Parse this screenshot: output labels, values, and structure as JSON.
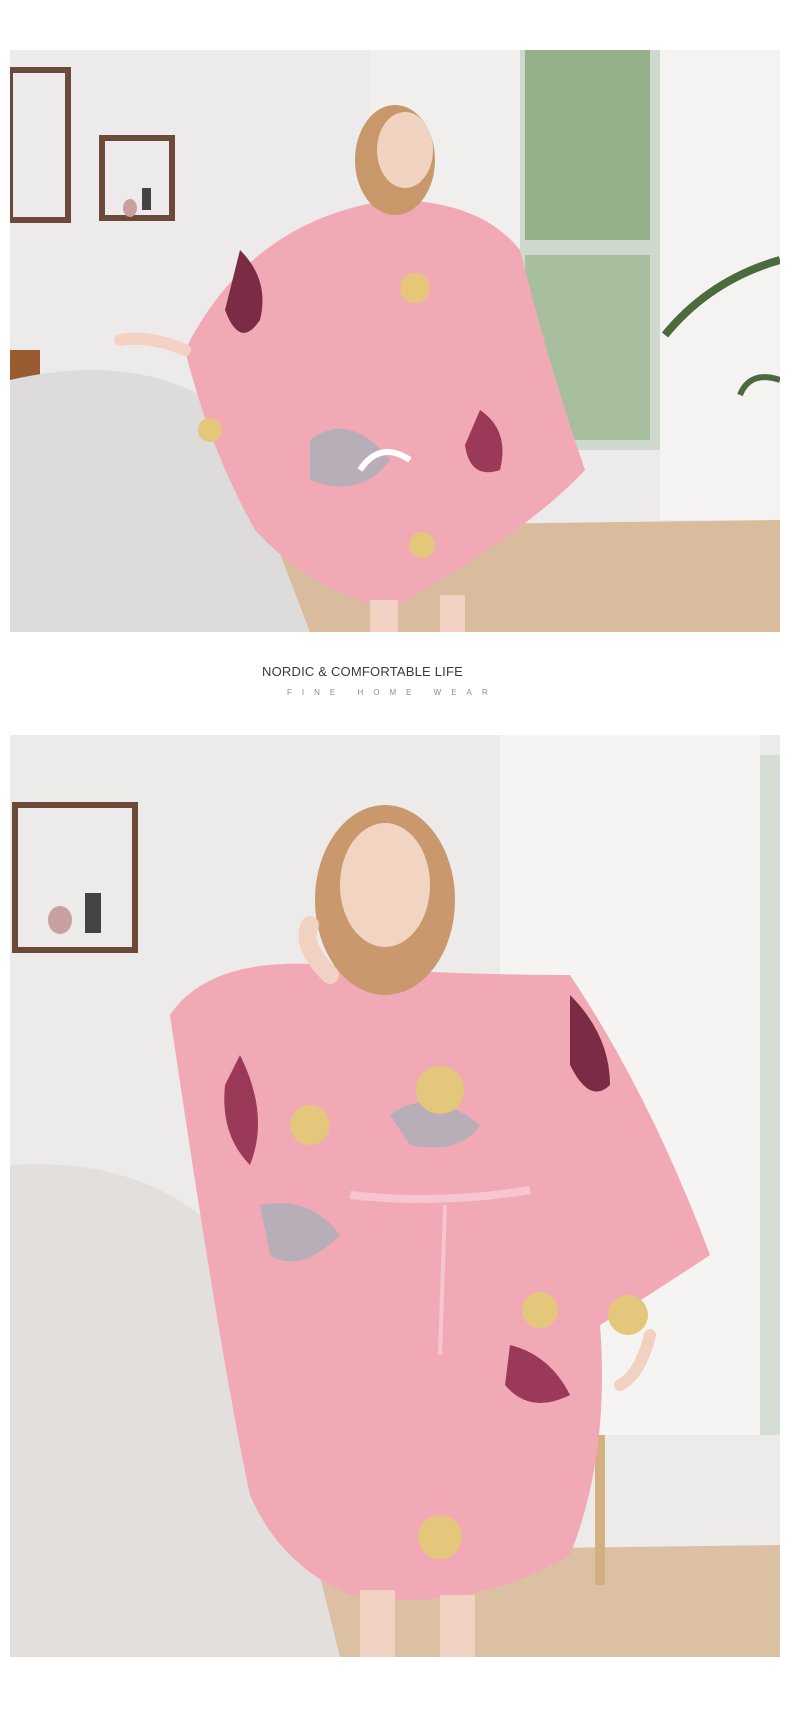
{
  "caption": {
    "title": "NORDIC & COMFORTABLE LIFE",
    "subtitle": "FINE HOME WEAR"
  },
  "colors": {
    "background": "#ffffff",
    "robe_pink": "#f2a9b6",
    "robe_dark_accent": "#7c2b44",
    "wall": "#eceaea",
    "floor": "#d8b89a"
  }
}
